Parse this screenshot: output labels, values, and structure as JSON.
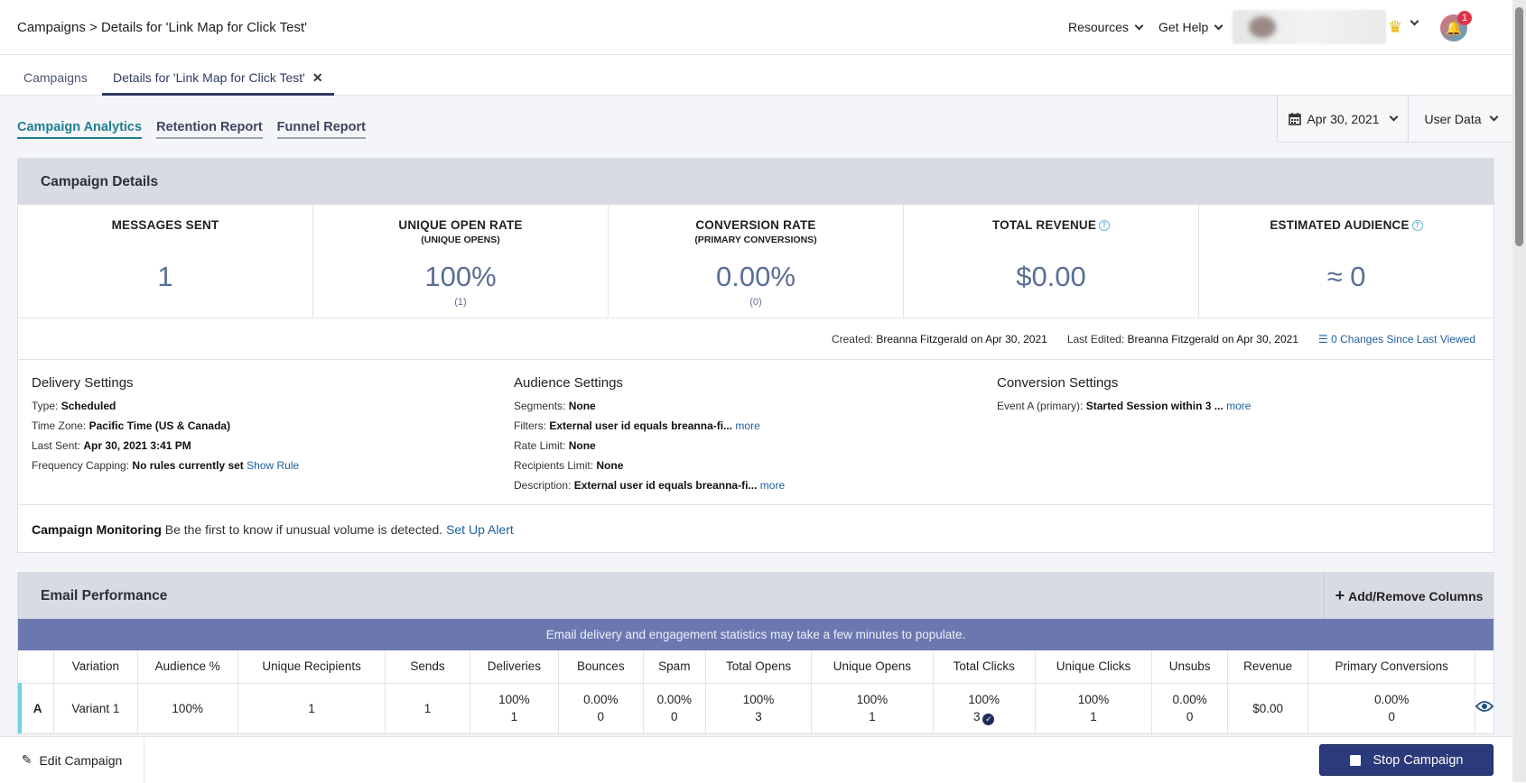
{
  "header": {
    "breadcrumb": "Campaigns > Details for 'Link Map for Click Test'",
    "resources": "Resources",
    "get_help": "Get Help",
    "notification_count": "1"
  },
  "tabs": {
    "campaigns": "Campaigns",
    "details": "Details for 'Link Map for Click Test'",
    "close": "✕"
  },
  "subtabs": [
    "Campaign Analytics",
    "Retention Report",
    "Funnel Report"
  ],
  "date_button": "Apr 30, 2021",
  "user_data_button": "User Data",
  "campaign_details": {
    "title": "Campaign Details",
    "stats": [
      {
        "title": "MESSAGES SENT",
        "sub": "",
        "value": "1",
        "count": ""
      },
      {
        "title": "UNIQUE OPEN RATE",
        "sub": "(UNIQUE OPENS)",
        "value": "100%",
        "count": "(1)"
      },
      {
        "title": "CONVERSION RATE",
        "sub": "(PRIMARY CONVERSIONS)",
        "value": "0.00%",
        "count": "(0)"
      },
      {
        "title": "TOTAL REVENUE",
        "sub": "",
        "value": "$0.00",
        "count": ""
      },
      {
        "title": "ESTIMATED AUDIENCE",
        "sub": "",
        "value": "≈ 0",
        "count": ""
      }
    ],
    "created_label": "Created:",
    "created_value": "Breanna Fitzgerald on Apr 30, 2021",
    "edited_label": "Last Edited:",
    "edited_value": "Breanna Fitzgerald on Apr 30, 2021",
    "changes_link": "0 Changes Since Last Viewed"
  },
  "delivery": {
    "title": "Delivery Settings",
    "type_label": "Type:",
    "type_value": "Scheduled",
    "tz_label": "Time Zone:",
    "tz_value": "Pacific Time (US & Canada)",
    "sent_label": "Last Sent:",
    "sent_value": "Apr 30, 2021 3:41 PM",
    "freq_label": "Frequency Capping:",
    "freq_value": "No rules currently set",
    "freq_link": "Show Rule"
  },
  "audience": {
    "title": "Audience Settings",
    "seg_label": "Segments:",
    "seg_value": "None",
    "filt_label": "Filters:",
    "filt_value": "External user id equals breanna-fi...",
    "filt_more": "more",
    "rate_label": "Rate Limit:",
    "rate_value": "None",
    "recip_label": "Recipients Limit:",
    "recip_value": "None",
    "desc_label": "Description:",
    "desc_value": "External user id equals breanna-fi...",
    "desc_more": "more"
  },
  "conversion": {
    "title": "Conversion Settings",
    "event_label": "Event A (primary):",
    "event_value": "Started Session within 3 ...",
    "event_more": "more"
  },
  "monitoring": {
    "label": "Campaign Monitoring",
    "text": "Be the first to know if unusual volume is detected.",
    "link": "Set Up Alert"
  },
  "email_performance": {
    "title": "Email Performance",
    "add_columns": "Add/Remove Columns",
    "banner": "Email delivery and engagement statistics may take a few minutes to populate.",
    "columns": [
      "",
      "Variation",
      "Audience %",
      "Unique Recipients",
      "Sends",
      "Deliveries",
      "Bounces",
      "Spam",
      "Total Opens",
      "Unique Opens",
      "Total Clicks",
      "Unique Clicks",
      "Unsubs",
      "Revenue",
      "Primary Conversions",
      ""
    ],
    "row": {
      "letter": "A",
      "variation": "Variant 1",
      "audience": "100%",
      "unique_recipients": "1",
      "sends": "1",
      "deliveries_pct": "100%",
      "deliveries_n": "1",
      "bounces_pct": "0.00%",
      "bounces_n": "0",
      "spam_pct": "0.00%",
      "spam_n": "0",
      "total_opens_pct": "100%",
      "total_opens_n": "3",
      "unique_opens_pct": "100%",
      "unique_opens_n": "1",
      "total_clicks_pct": "100%",
      "total_clicks_n": "3",
      "unique_clicks_pct": "100%",
      "unique_clicks_n": "1",
      "unsubs_pct": "0.00%",
      "unsubs_n": "0",
      "revenue": "$0.00",
      "conv_pct": "0.00%",
      "conv_n": "0"
    }
  },
  "bottom": {
    "edit": "Edit Campaign",
    "stop": "Stop Campaign"
  },
  "icons": [
    "chevron-down-icon",
    "crown-icon",
    "bell-icon",
    "calendar-icon",
    "info-icon",
    "list-icon",
    "plus-icon",
    "check-circle-icon",
    "eye-icon",
    "pencil-icon",
    "stop-icon"
  ],
  "colors": {
    "accent": "#1f7f93",
    "banner": "#6b78b0",
    "stop_button": "#2b3a7a",
    "stat_value": "#5a6f95",
    "link": "#1d5f9e"
  }
}
